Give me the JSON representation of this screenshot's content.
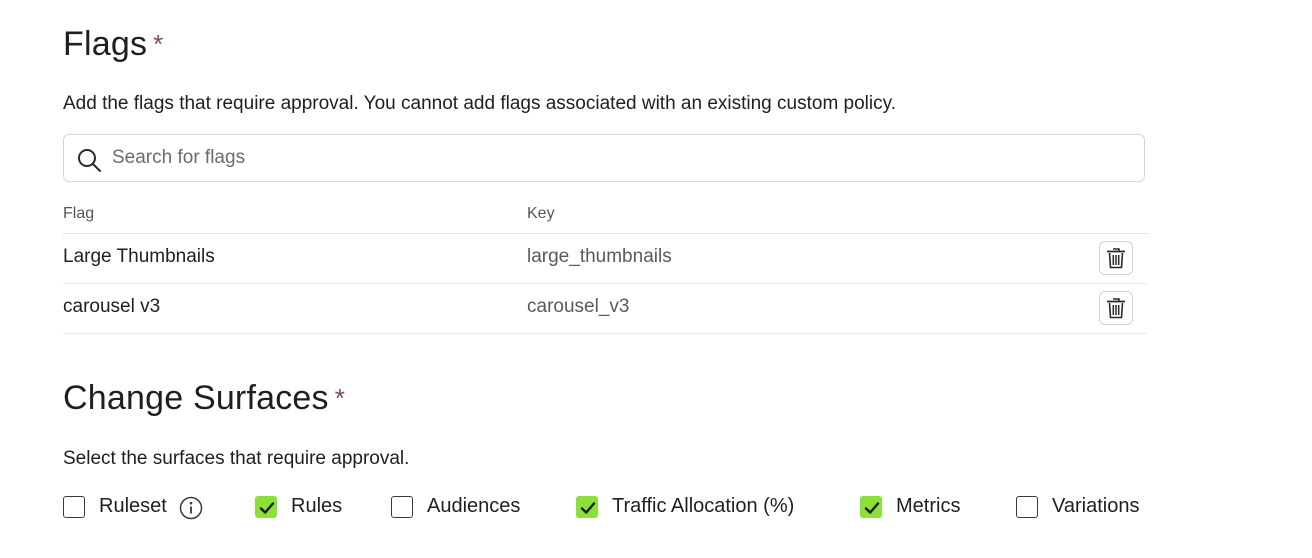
{
  "flags_section": {
    "title": "Flags",
    "required_marker": "*",
    "description": "Add the flags that require approval. You cannot add flags associated with an existing custom policy.",
    "search": {
      "placeholder": "Search for flags",
      "value": "",
      "icon": "search-icon"
    },
    "table": {
      "columns": [
        "Flag",
        "Key"
      ],
      "rows": [
        {
          "flag": "Large Thumbnails",
          "key": "large_thumbnails",
          "action_icon": "trash-icon"
        },
        {
          "flag": "carousel v3",
          "key": "carousel_v3",
          "action_icon": "trash-icon"
        }
      ]
    }
  },
  "surfaces_section": {
    "title": "Change Surfaces",
    "required_marker": "*",
    "description": "Select the surfaces that require approval.",
    "options": [
      {
        "label": "Ruleset",
        "checked": false,
        "info_icon": "info-icon"
      },
      {
        "label": "Rules",
        "checked": true
      },
      {
        "label": "Audiences",
        "checked": false
      },
      {
        "label": "Traffic Allocation (%)",
        "checked": true
      },
      {
        "label": "Metrics",
        "checked": true
      },
      {
        "label": "Variations",
        "checked": false
      }
    ]
  },
  "colors": {
    "accent_checked": "#8be03a",
    "required_marker": "#7a4a62",
    "text": "#1f1f1f",
    "muted_text": "#5a5a5a",
    "border": "#d6d6d6"
  }
}
